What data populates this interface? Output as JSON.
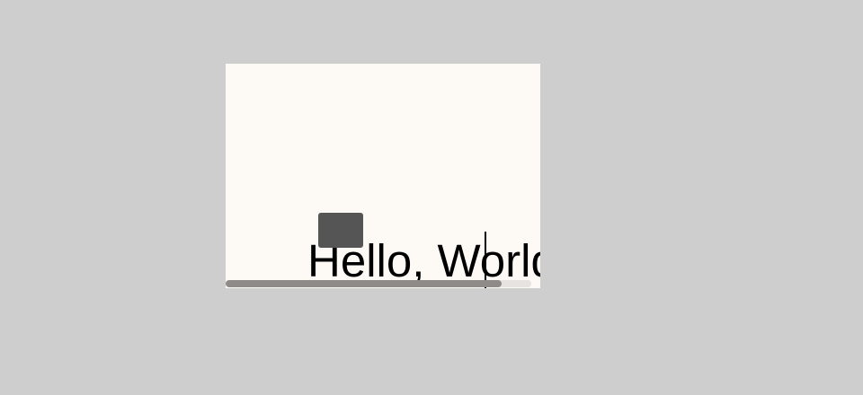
{
  "editor": {
    "text": "Hello, World",
    "scroll_position_fraction": 0.9
  },
  "colors": {
    "page_background": "#cecece",
    "editor_background": "#fdf9f5",
    "text": "#000000",
    "popup": "#555555",
    "scroll_thumb": "#8e8b88",
    "scroll_track": "#e6e3e0"
  }
}
